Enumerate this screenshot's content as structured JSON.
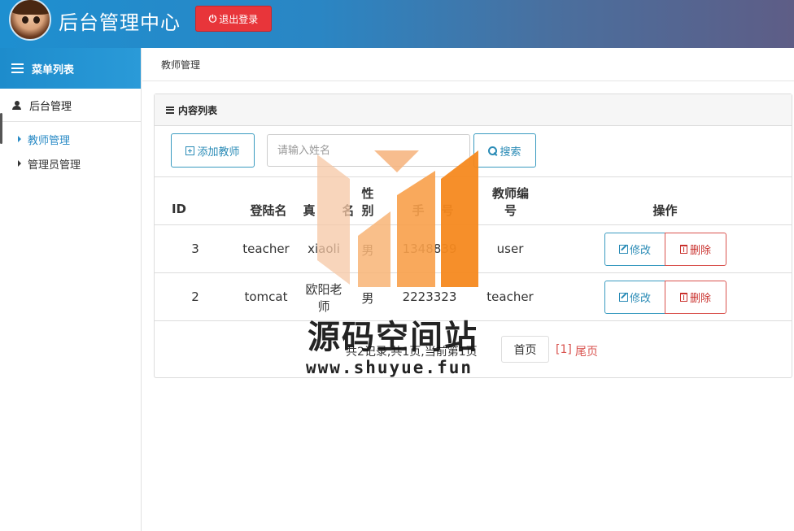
{
  "header": {
    "app_title": "后台管理中心",
    "logout_label": "退出登录"
  },
  "sidebar": {
    "menu_title": "菜单列表",
    "group_title": "后台管理",
    "items": [
      {
        "label": "教师管理",
        "active": true
      },
      {
        "label": "管理员管理",
        "active": false
      }
    ]
  },
  "breadcrumb": "教师管理",
  "panel": {
    "title": "内容列表",
    "add_button": "添加教师",
    "search_placeholder": "请输入姓名",
    "search_value": "",
    "search_button": "搜索"
  },
  "table": {
    "headers": {
      "id": "ID",
      "login": "登陆名",
      "real_name_1": "真",
      "real_name_2": "名",
      "gender_1": "性",
      "gender_2": "别",
      "phone_1": "手",
      "phone_2": "号",
      "teacher_no_1": "教师编",
      "teacher_no_2": "号",
      "ops": "操作"
    },
    "rows": [
      {
        "id": "3",
        "login": "teacher",
        "real_name": "xiaoli",
        "gender": "男",
        "phone": "1348839",
        "teacher_no": "user"
      },
      {
        "id": "2",
        "login": "tomcat",
        "real_name_1": "欧阳老",
        "real_name_2": "师",
        "gender": "男",
        "phone": "2223323",
        "teacher_no": "teacher"
      }
    ],
    "edit_label": "修改",
    "delete_label": "删除"
  },
  "pager": {
    "summary": "共2记录,共1页,当前第1页",
    "first": "首页",
    "current": "[1]",
    "last": "尾页"
  },
  "watermark": {
    "title": "源码空间站",
    "url": "www.shuyue.fun"
  },
  "colors": {
    "header_gradient_start": "#1e8fd0",
    "header_gradient_end": "#5e5d86",
    "logout_red": "#e8353a",
    "accent_blue": "#2a8bb6",
    "danger_red": "#d9534f",
    "watermark_orange": "#f5891f"
  }
}
